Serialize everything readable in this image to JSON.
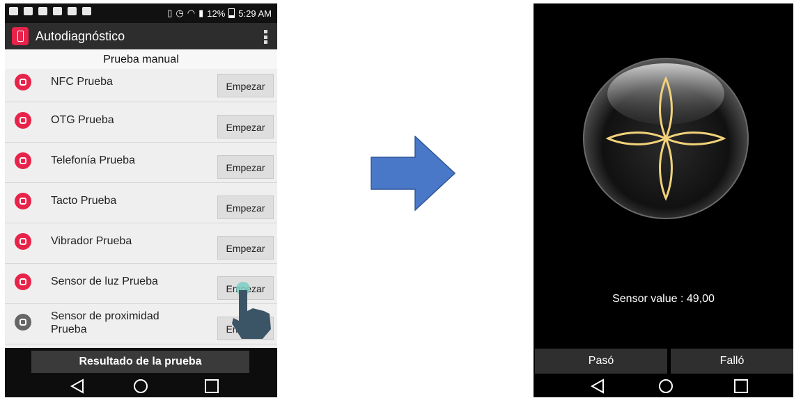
{
  "left_phone": {
    "status_bar": {
      "battery": "12%",
      "time": "5:29 AM"
    },
    "app_title": "Autodiagnóstico",
    "section_title": "Prueba manual",
    "tests": [
      {
        "label": "NFC Prueba",
        "icon": "nfc-icon",
        "button": "Empezar"
      },
      {
        "label": "OTG Prueba",
        "icon": "otg-icon",
        "button": "Empezar"
      },
      {
        "label": "Telefonía Prueba",
        "icon": "telephony-icon",
        "button": "Empezar"
      },
      {
        "label": "Tacto Prueba",
        "icon": "touch-icon",
        "button": "Empezar"
      },
      {
        "label": "Vibrador Prueba",
        "icon": "vibrator-icon",
        "button": "Empezar"
      },
      {
        "label": "Sensor de luz Prueba",
        "icon": "light-sensor-icon",
        "button": "Empezar"
      },
      {
        "label": "Sensor de proximidad Prueba",
        "icon": "proximity-sensor-icon",
        "button": "Empezar"
      }
    ],
    "results_button": "Resultado de la prueba"
  },
  "right_phone": {
    "sensor_value_text": "Sensor value : 49,00",
    "pass_button": "Pasó",
    "fail_button": "Falló"
  },
  "colors": {
    "accent": "#e8234a",
    "arrow": "#4a78c8"
  }
}
